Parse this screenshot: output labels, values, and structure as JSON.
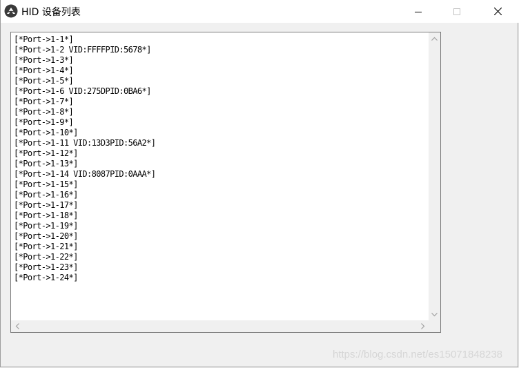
{
  "window": {
    "title": "HID 设备列表",
    "icon": "app-logo-icon",
    "controls": {
      "minimize": "minimize-icon",
      "maximize": "maximize-icon",
      "close": "close-icon"
    }
  },
  "list": {
    "items": [
      "[*Port->1-1*]",
      "[*Port->1-2 VID:FFFFPID:5678*]",
      "[*Port->1-3*]",
      "[*Port->1-4*]",
      "[*Port->1-5*]",
      "[*Port->1-6 VID:275DPID:0BA6*]",
      "[*Port->1-7*]",
      "[*Port->1-8*]",
      "[*Port->1-9*]",
      "[*Port->1-10*]",
      "[*Port->1-11 VID:13D3PID:56A2*]",
      "[*Port->1-12*]",
      "[*Port->1-13*]",
      "[*Port->1-14 VID:8087PID:0AAA*]",
      "[*Port->1-15*]",
      "[*Port->1-16*]",
      "[*Port->1-17*]",
      "[*Port->1-18*]",
      "[*Port->1-19*]",
      "[*Port->1-20*]",
      "[*Port->1-21*]",
      "[*Port->1-22*]",
      "[*Port->1-23*]",
      "[*Port->1-24*]"
    ]
  },
  "scrollbars": {
    "up": "scroll-up-icon",
    "down": "scroll-down-icon",
    "left": "scroll-left-icon",
    "right": "scroll-right-icon"
  },
  "watermark": "https://blog.csdn.net/es15071848238",
  "colors": {
    "titlebar": "#ffffff",
    "window_bg": "#f0f0f0",
    "list_bg": "#ffffff",
    "list_border": "#7a7a7a",
    "scrollbar_arrow": "#a0a0a0"
  }
}
